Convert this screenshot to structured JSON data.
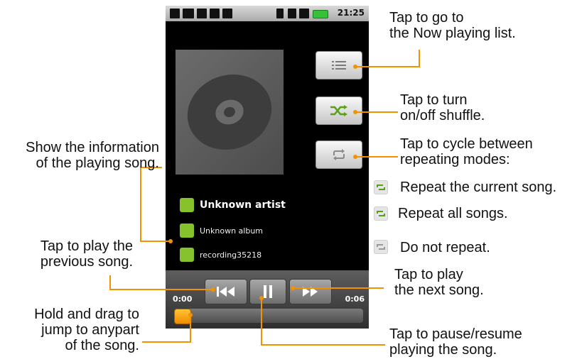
{
  "status_bar": {
    "time": "21:25"
  },
  "song": {
    "artist": "Unknown artist",
    "album": "Unknown album",
    "title": "recording35218"
  },
  "playback": {
    "elapsed": "0:00",
    "duration": "0:06",
    "progress": 0.0
  },
  "callouts": {
    "now_playing": [
      "Tap to go to",
      "the  Now playing list."
    ],
    "shuffle": [
      "Tap to turn",
      "on/off shuffle."
    ],
    "repeat": [
      "Tap to cycle between",
      "repeating modes:"
    ],
    "repeat_current": "Repeat the current song.",
    "repeat_all": "Repeat all songs.",
    "no_repeat": "Do not repeat.",
    "song_info": [
      "Show the information",
      "of the playing song."
    ],
    "previous": [
      "Tap to play the",
      "previous song."
    ],
    "next": [
      "Tap to play",
      "the next song."
    ],
    "seek": [
      "Hold and drag to",
      "jump to anypart",
      "of the song."
    ],
    "pause": [
      "Tap to pause/resume",
      "playing the song."
    ]
  },
  "colors": {
    "callout_line": "#f39200",
    "accent_green": "#86c22b",
    "seek_thumb": "#f5a000"
  },
  "icons": [
    "now-playing-list-icon",
    "shuffle-icon",
    "repeat-icon",
    "previous-icon",
    "pause-icon",
    "next-icon"
  ]
}
